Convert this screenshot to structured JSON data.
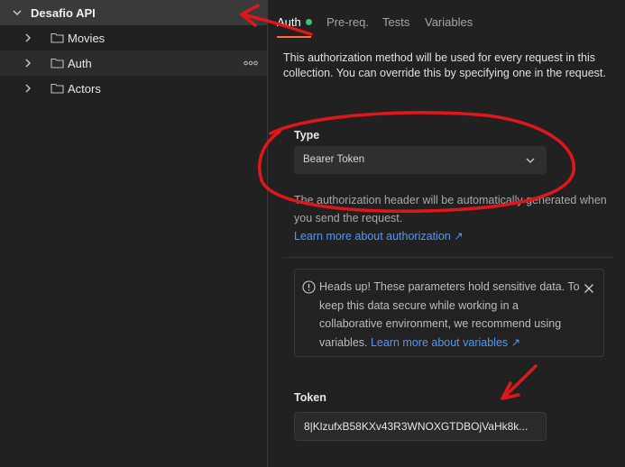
{
  "sidebar": {
    "collection": {
      "label": "Desafio API",
      "icon": "chevron-down-icon"
    },
    "items": [
      {
        "label": "Movies",
        "icon": "folder-icon"
      },
      {
        "label": "Auth",
        "icon": "folder-icon",
        "more_icon": "more-horizontal-icon"
      },
      {
        "label": "Actors",
        "icon": "folder-icon"
      }
    ]
  },
  "tabs": [
    {
      "label": "Auth",
      "active": true,
      "status_dot_color": "#3ec46d"
    },
    {
      "label": "Pre-req."
    },
    {
      "label": "Tests"
    },
    {
      "label": "Variables"
    }
  ],
  "auth": {
    "description": "This authorization method will be used for every request in this collection. You can override this by specifying one in the request.",
    "type_label": "Type",
    "type_value": "Bearer Token",
    "note": "The authorization header will be automatically generated when you send the request.",
    "learn_more": "Learn more about authorization ↗",
    "alert_text": "Heads up! These parameters hold sensitive data. To keep this data secure while working in a collaborative environment, we recommend using variables.",
    "alert_link": "Learn more about variables ↗",
    "token_label": "Token",
    "token_value": "8|KlzufxB58KXv43R3WNOXGTDBOjVaHk8k..."
  },
  "colors": {
    "accent": "#ff6c37",
    "link": "#4d9aff",
    "annotation": "#e0171a"
  }
}
